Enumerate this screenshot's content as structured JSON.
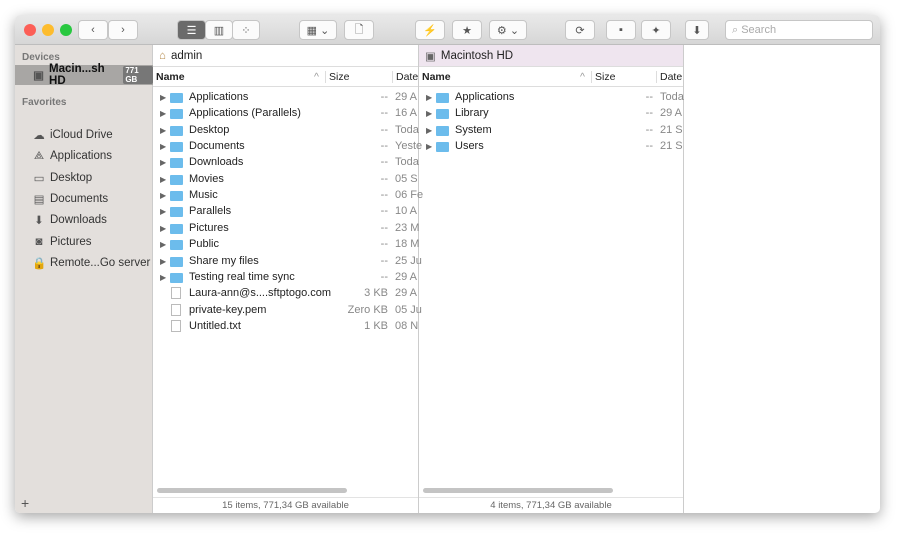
{
  "toolbar": {
    "search_placeholder": "Search"
  },
  "sidebar": {
    "devices_header": "Devices",
    "device": {
      "label": "Macin...sh HD",
      "badge": "771 GB"
    },
    "favorites_header": "Favorites",
    "favorites": [
      {
        "label": "iCloud Drive",
        "icon": "cloud-icon"
      },
      {
        "label": "Applications",
        "icon": "applications-icon"
      },
      {
        "label": "Desktop",
        "icon": "desktop-icon"
      },
      {
        "label": "Documents",
        "icon": "documents-icon"
      },
      {
        "label": "Downloads",
        "icon": "downloads-icon"
      },
      {
        "label": "Pictures",
        "icon": "camera-icon"
      },
      {
        "label": "Remote...Go server",
        "icon": "lock-icon"
      }
    ],
    "add": "+"
  },
  "left_pane": {
    "path": "admin",
    "columns": {
      "name": "Name",
      "size": "Size",
      "date": "Date"
    },
    "rows": [
      {
        "name": "Applications",
        "size": "--",
        "date": "29 A",
        "folder": true
      },
      {
        "name": "Applications (Parallels)",
        "size": "--",
        "date": "16 A",
        "folder": true
      },
      {
        "name": "Desktop",
        "size": "--",
        "date": "Toda",
        "folder": true
      },
      {
        "name": "Documents",
        "size": "--",
        "date": "Yeste",
        "folder": true
      },
      {
        "name": "Downloads",
        "size": "--",
        "date": "Toda",
        "folder": true
      },
      {
        "name": "Movies",
        "size": "--",
        "date": "05 S",
        "folder": true
      },
      {
        "name": "Music",
        "size": "--",
        "date": "06 Fe",
        "folder": true
      },
      {
        "name": "Parallels",
        "size": "--",
        "date": "10 A",
        "folder": true
      },
      {
        "name": "Pictures",
        "size": "--",
        "date": "23 M",
        "folder": true
      },
      {
        "name": "Public",
        "size": "--",
        "date": "18 M",
        "folder": true
      },
      {
        "name": "Share my files",
        "size": "--",
        "date": "25 Ju",
        "folder": true
      },
      {
        "name": "Testing real time sync",
        "size": "--",
        "date": "29 A",
        "folder": true
      },
      {
        "name": "Laura-ann@s....sftptogo.com",
        "size": "3 KB",
        "date": "29 A",
        "folder": false
      },
      {
        "name": "private-key.pem",
        "size": "Zero KB",
        "date": "05 Ju",
        "folder": false
      },
      {
        "name": "Untitled.txt",
        "size": "1 KB",
        "date": "08 N",
        "folder": false
      }
    ],
    "status": "15 items, 771,34 GB available"
  },
  "right_pane": {
    "path": "Macintosh HD",
    "columns": {
      "name": "Name",
      "size": "Size",
      "date": "Date"
    },
    "rows": [
      {
        "name": "Applications",
        "size": "--",
        "date": "Toda",
        "folder": true
      },
      {
        "name": "Library",
        "size": "--",
        "date": "29 A",
        "folder": true
      },
      {
        "name": "System",
        "size": "--",
        "date": "21 S",
        "folder": true
      },
      {
        "name": "Users",
        "size": "--",
        "date": "21 S",
        "folder": true
      }
    ],
    "status": "4 items, 771,34 GB available"
  }
}
